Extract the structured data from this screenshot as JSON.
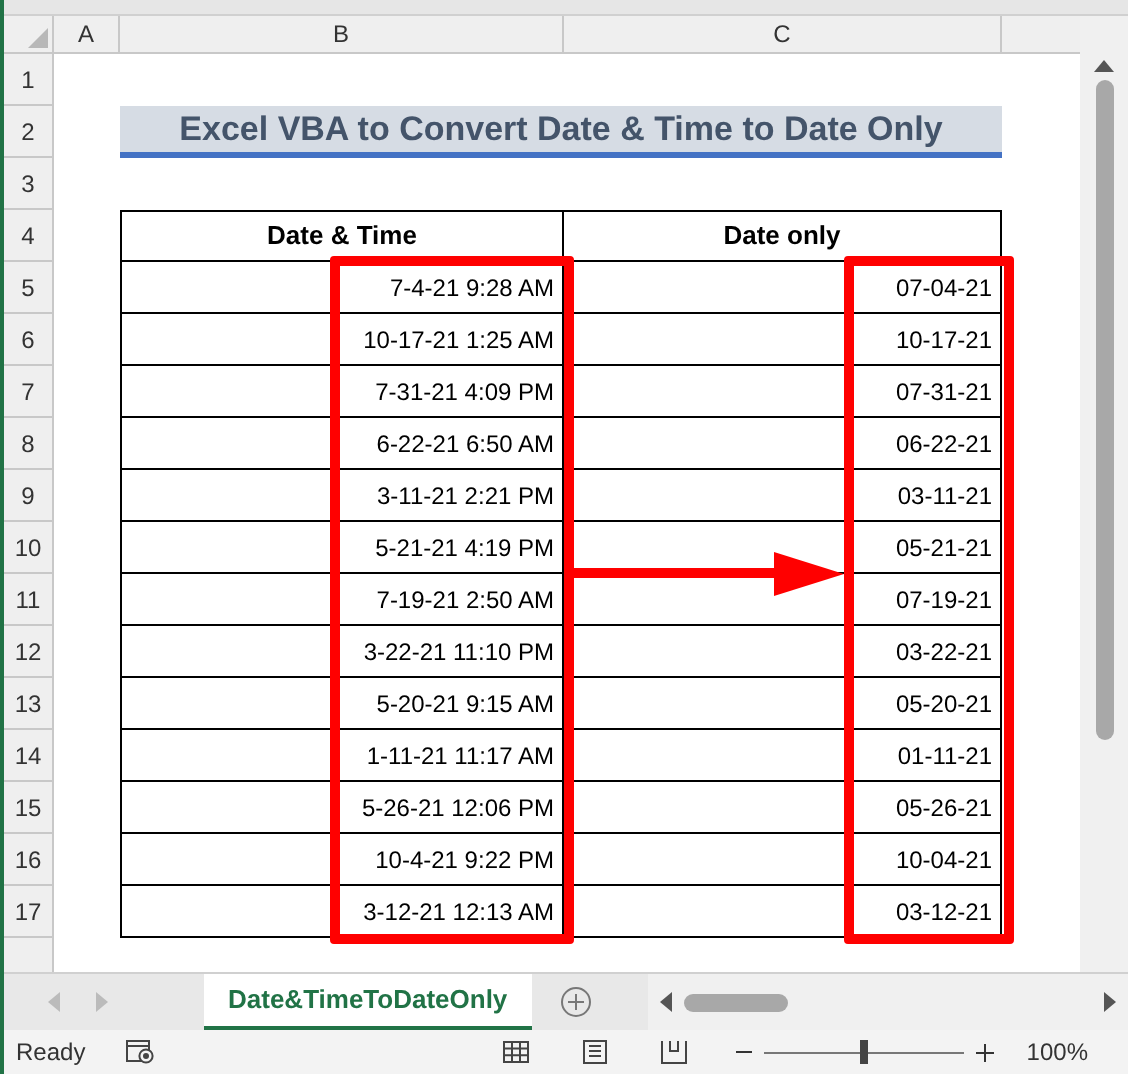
{
  "columns": [
    "A",
    "B",
    "C"
  ],
  "row_numbers": [
    "1",
    "2",
    "3",
    "4",
    "5",
    "6",
    "7",
    "8",
    "9",
    "10",
    "11",
    "12",
    "13",
    "14",
    "15",
    "16",
    "17"
  ],
  "title": "Excel VBA to Convert Date & Time to Date Only",
  "table": {
    "columns": [
      "Date & Time",
      "Date only"
    ],
    "rows": [
      [
        "7-4-21 9:28 AM",
        "07-04-21"
      ],
      [
        "10-17-21 1:25 AM",
        "10-17-21"
      ],
      [
        "7-31-21 4:09 PM",
        "07-31-21"
      ],
      [
        "6-22-21 6:50 AM",
        "06-22-21"
      ],
      [
        "3-11-21 2:21 PM",
        "03-11-21"
      ],
      [
        "5-21-21 4:19 PM",
        "05-21-21"
      ],
      [
        "7-19-21 2:50 AM",
        "07-19-21"
      ],
      [
        "3-22-21 11:10 PM",
        "03-22-21"
      ],
      [
        "5-20-21 9:15 AM",
        "05-20-21"
      ],
      [
        "1-11-21 11:17 AM",
        "01-11-21"
      ],
      [
        "5-26-21 12:06 PM",
        "05-26-21"
      ],
      [
        "10-4-21 9:22 PM",
        "10-04-21"
      ],
      [
        "3-12-21 12:13 AM",
        "03-12-21"
      ]
    ]
  },
  "sheet_tabs": [
    {
      "label": "Date&TimeToDateOnly",
      "selected": true
    }
  ],
  "status_bar": {
    "status": "Ready",
    "zoom": {
      "level": 0.5,
      "reading": "100%"
    }
  }
}
